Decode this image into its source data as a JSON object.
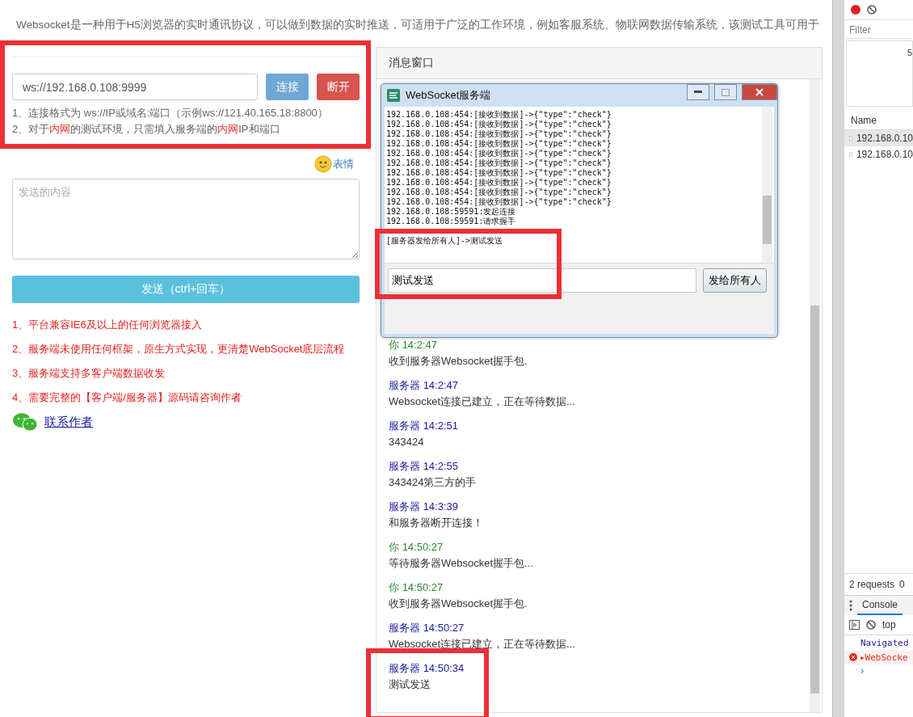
{
  "intro": "Websocket是一种用于H5浏览器的实时通讯协议，可以做到数据的实时推送，可适用于广泛的工作环境，例如客服系统、物联网数据传输系统，该测试工具可用于",
  "connection": {
    "url": "ws://192.168.0.108:9999",
    "connect_label": "连接",
    "disconnect_label": "断开"
  },
  "hints": [
    [
      {
        "text": "1、连接格式为 ws://IP或域名:端口（示例ws://121.40.165.18:8800）",
        "highlight": false
      }
    ],
    [
      {
        "text": "2、对于",
        "highlight": false
      },
      {
        "text": "内网",
        "highlight": true
      },
      {
        "text": "的测试环境，只需填入服务端的",
        "highlight": false
      },
      {
        "text": "内网",
        "highlight": true
      },
      {
        "text": "IP和端口",
        "highlight": false
      }
    ]
  ],
  "emoji_label": "表情",
  "compose": {
    "placeholder": "发送的内容",
    "send_label": "发送（ctrl+回车）"
  },
  "features": [
    "1、平台兼容IE6及以上的任何浏览器接入",
    "2、服务端未使用任何框架，原生方式实现，更清楚WebSocket底层流程",
    "3、服务端支持多客户端数据收发",
    "4、需要完整的【客户端/服务器】源码请咨询作者"
  ],
  "contact_link": "联系作者",
  "message_window": {
    "title": "消息窗口",
    "messages": [
      {
        "kind": "client",
        "sender": "你",
        "time": "14:2:47",
        "text": "收到服务器Websocket握手包."
      },
      {
        "kind": "server",
        "sender": "服务器",
        "time": "14:2:47",
        "text": "Websocket连接已建立，正在等待数据..."
      },
      {
        "kind": "server",
        "sender": "服务器",
        "time": "14:2:51",
        "text": "343424"
      },
      {
        "kind": "server",
        "sender": "服务器",
        "time": "14:2:55",
        "text": "343424第三方的手"
      },
      {
        "kind": "server",
        "sender": "服务器",
        "time": "14:3:39",
        "text": "和服务器断开连接！"
      },
      {
        "kind": "client",
        "sender": "你",
        "time": "14:50:27",
        "text": "等待服务器Websocket握手包..."
      },
      {
        "kind": "client",
        "sender": "你",
        "time": "14:50:27",
        "text": "收到服务器Websocket握手包."
      },
      {
        "kind": "server",
        "sender": "服务器",
        "time": "14:50:27",
        "text": "Websocket连接已建立，正在等待数据..."
      },
      {
        "kind": "server",
        "sender": "服务器",
        "time": "14:50:34",
        "text": "测试发送"
      }
    ]
  },
  "server_window": {
    "title": "WebSocket服务端",
    "log": [
      "192.168.0.108:454:[接收到数据]->{\"type\":\"check\"}",
      "192.168.0.108:454:[接收到数据]->{\"type\":\"check\"}",
      "192.168.0.108:454:[接收到数据]->{\"type\":\"check\"}",
      "192.168.0.108:454:[接收到数据]->{\"type\":\"check\"}",
      "192.168.0.108:454:[接收到数据]->{\"type\":\"check\"}",
      "192.168.0.108:454:[接收到数据]->{\"type\":\"check\"}",
      "192.168.0.108:454:[接收到数据]->{\"type\":\"check\"}",
      "192.168.0.108:454:[接收到数据]->{\"type\":\"check\"}",
      "192.168.0.108:454:[接收到数据]->{\"type\":\"check\"}",
      "192.168.0.108:454:[接收到数据]->{\"type\":\"check\"}",
      "192.168.0.108:59591:发起连接",
      "192.168.0.108:59591:请求握手",
      "[服务器发给所有人]->测试发送"
    ],
    "input": "测试发送",
    "send_all_label": "发给所有人"
  },
  "devtools": {
    "filter_placeholder": "Filter",
    "overview_tick": "5",
    "name_header": "Name",
    "requests": [
      {
        "name": "192.168.0.10",
        "selected": true
      },
      {
        "name": "192.168.0.10",
        "selected": false
      }
    ],
    "summary": "2 requests",
    "summary_extra": "0",
    "console_tab": "Console",
    "context": "top",
    "console": [
      {
        "kind": "info",
        "text": "Navigated"
      },
      {
        "kind": "error",
        "text": "▸WebSocke"
      }
    ],
    "prompt": "›"
  }
}
